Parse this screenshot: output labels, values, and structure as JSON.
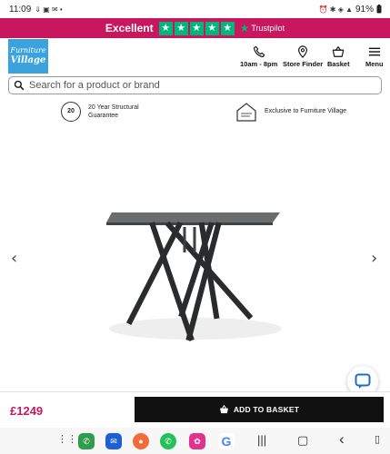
{
  "status_bar": {
    "time": "11:09",
    "left_glyphs": "⇓ ▣ ✉ •",
    "right_glyphs": "⏰ ✱ ◈ ▲",
    "battery": "91%"
  },
  "trust_banner": {
    "rating_word": "Excellent",
    "stars": [
      "★",
      "★",
      "★",
      "★",
      "★"
    ],
    "brand_star": "★",
    "brand": "Trustpilot"
  },
  "header": {
    "logo_line1": "Furniture",
    "logo_line2": "Village",
    "nav": {
      "hours": "10am - 8pm",
      "store_finder": "Store Finder",
      "basket": "Basket",
      "menu": "Menu"
    }
  },
  "search": {
    "placeholder": "Search for a product or brand"
  },
  "usps": {
    "guarantee_badge": "20",
    "guarantee_line1": "20 Year Structural",
    "guarantee_line2": "Guarantee",
    "exclusive_text": "Exclusive to Furniture Village"
  },
  "carousel": {
    "prev": "‹",
    "next": "›"
  },
  "buy_bar": {
    "price": "£1249",
    "add_label": "ADD TO BASKET"
  },
  "android_nav": {
    "recents": "|||",
    "home": "▢",
    "back": "‹"
  },
  "colors": {
    "brand_pink": "#c8175e",
    "trust_green": "#00b67a",
    "logo_blue": "#3aa3dd"
  }
}
